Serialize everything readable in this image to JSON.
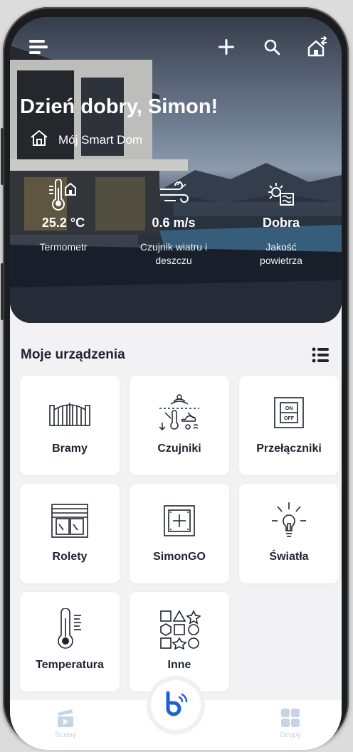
{
  "header": {
    "greeting": "Dzień dobry, Simon!",
    "home_name": "Mój Smart Dom"
  },
  "stats": [
    {
      "value": "25.2 °C",
      "label": "Termometr",
      "icon": "thermometer-icon"
    },
    {
      "value": "0.6 m/s",
      "label": "Czujnik wiatru i deszczu",
      "icon": "wind-icon"
    },
    {
      "value": "Dobra",
      "label": "Jakość powietrza",
      "icon": "air-quality-icon"
    }
  ],
  "devices": {
    "title": "Moje urządzenia",
    "tiles": [
      {
        "label": "Bramy",
        "icon": "gate-icon"
      },
      {
        "label": "Czujniki",
        "icon": "sensors-icon"
      },
      {
        "label": "Przełączniki",
        "icon": "switch-icon",
        "switch_on": "ON",
        "switch_off": "OFF"
      },
      {
        "label": "Rolety",
        "icon": "blinds-icon"
      },
      {
        "label": "SimonGO",
        "icon": "simongo-icon"
      },
      {
        "label": "Światła",
        "icon": "light-bulb-icon"
      },
      {
        "label": "Temperatura",
        "icon": "temperature-icon"
      },
      {
        "label": "Inne",
        "icon": "shapes-icon"
      }
    ]
  },
  "nav": {
    "left_label": "Sceny",
    "right_label": "Grupy"
  },
  "colors": {
    "text_dark": "#1f2330",
    "nav_inactive": "#c6d4e4",
    "accent_blue": "#1f5fd6"
  }
}
